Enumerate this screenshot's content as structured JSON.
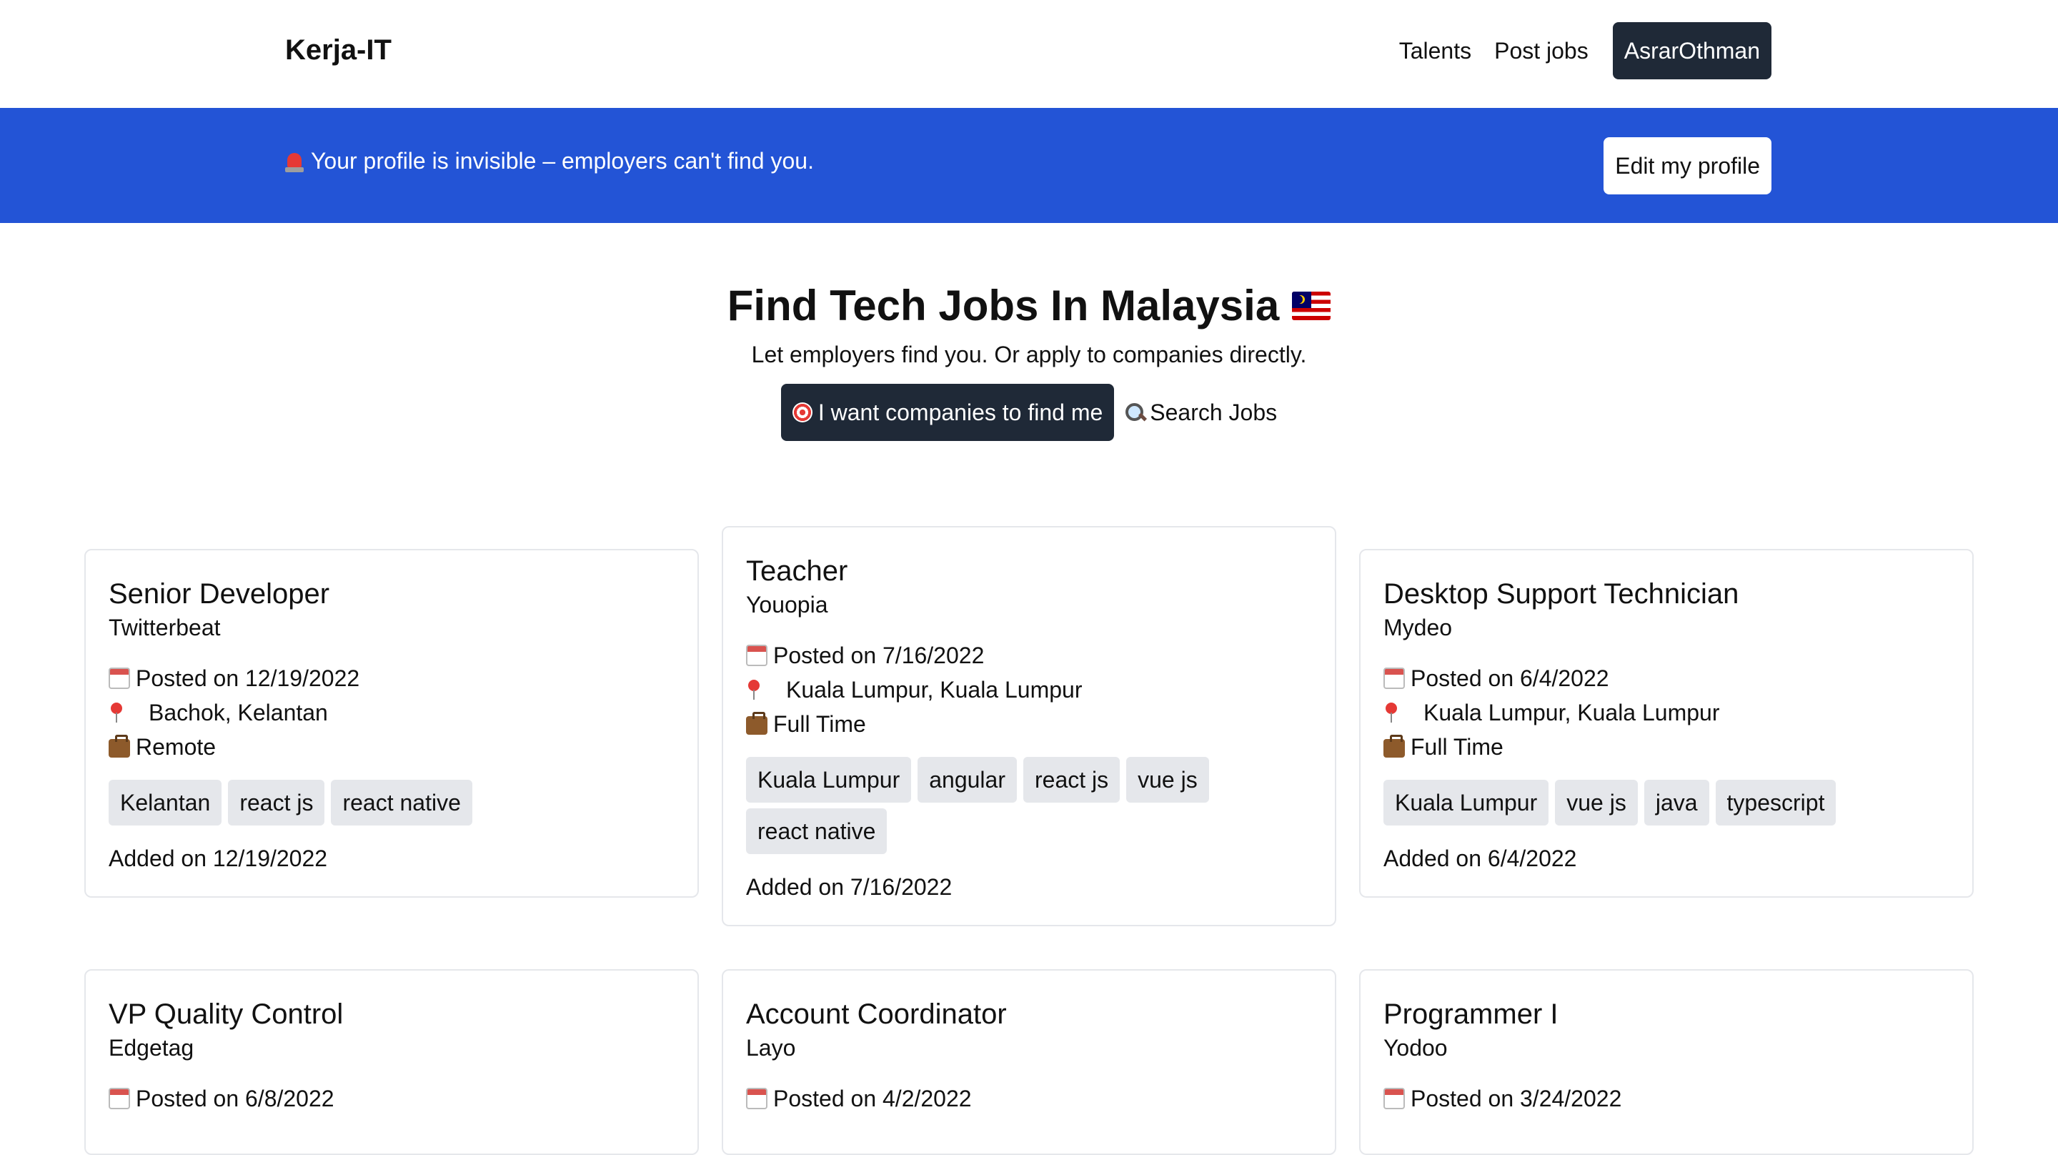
{
  "nav": {
    "brand": "Kerja-IT",
    "links": [
      "Talents",
      "Post jobs"
    ],
    "user": "AsrarOthman"
  },
  "banner": {
    "icon": "siren-icon",
    "message": "Your profile is invisible – employers can't find you.",
    "button": "Edit my profile",
    "color": "#2354d6"
  },
  "hero": {
    "title": "Find Tech Jobs In Malaysia",
    "flag_icon": "malaysia-flag-icon",
    "subtitle": "Let employers find you. Or apply to companies directly.",
    "primary_button": "I want companies to find me",
    "secondary_button": "Search Jobs"
  },
  "jobs": [
    {
      "title": "Senior Developer",
      "company": "Twitterbeat",
      "posted": "Posted on 12/19/2022",
      "location": "Bachok, Kelantan",
      "type": "Remote",
      "tags": [
        "Kelantan",
        "react js",
        "react native"
      ],
      "added": "Added on 12/19/2022"
    },
    {
      "title": "Teacher",
      "company": "Youopia",
      "posted": "Posted on 7/16/2022",
      "location": "Kuala Lumpur, Kuala Lumpur",
      "type": "Full Time",
      "tags": [
        "Kuala Lumpur",
        "angular",
        "react js",
        "vue js",
        "react native"
      ],
      "added": "Added on 7/16/2022"
    },
    {
      "title": "Desktop Support Technician",
      "company": "Mydeo",
      "posted": "Posted on 6/4/2022",
      "location": "Kuala Lumpur, Kuala Lumpur",
      "type": "Full Time",
      "tags": [
        "Kuala Lumpur",
        "vue js",
        "java",
        "typescript"
      ],
      "added": "Added on 6/4/2022"
    },
    {
      "title": "VP Quality Control",
      "company": "Edgetag",
      "posted": "Posted on 6/8/2022"
    },
    {
      "title": "Account Coordinator",
      "company": "Layo",
      "posted": "Posted on 4/2/2022"
    },
    {
      "title": "Programmer I",
      "company": "Yodoo",
      "posted": "Posted on 3/24/2022"
    }
  ]
}
